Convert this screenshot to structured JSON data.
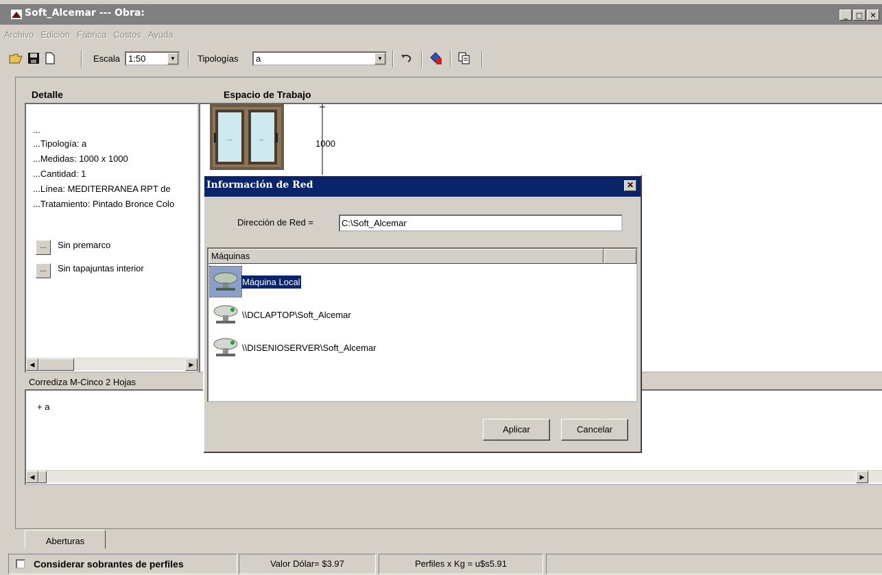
{
  "window": {
    "title": "Soft_Alcemar --- Obra:",
    "controls": [
      "_",
      "□",
      "✕"
    ]
  },
  "menu": [
    "Archivo",
    "Edición",
    "Fábrica",
    "Costos",
    "Ayuda"
  ],
  "toolbar": {
    "scale_label": "Escala",
    "scale_value": "1:50",
    "typologies_label": "Tipologías",
    "typologies_value": "a"
  },
  "detail": {
    "heading": "Detalle",
    "lines": [
      "...",
      "...Tipología: a",
      "...Medidas: 1000 x 1000",
      "...Cantidad: 1",
      "...Línea: MEDITERRANEA RPT de",
      "...Tratamiento: Pintado Bronce Colo"
    ],
    "button_glyph": "...",
    "buttons": [
      "Sin premarco",
      "Sin tapajuntas interior"
    ]
  },
  "workspace": {
    "heading": "Espacio de Trabajo",
    "dimension": "1000"
  },
  "product_label": "Corrediza M-Cinco 2 Hojas",
  "bottom_list": [
    "+ a"
  ],
  "tabs": [
    "Aberturas"
  ],
  "status": {
    "checkbox_label": "Considerar sobrantes de perfiles",
    "checkbox_checked": false,
    "dollar": "Valor Dólar= $3.97",
    "profiles": "Perfiles x Kg = u$s5.91"
  },
  "dialog": {
    "title": "Información de Red",
    "close_glyph": "✕",
    "address_label": "Dirección de Red =",
    "address_value": "C:\\Soft_Alcemar",
    "list_header": "Máquinas",
    "machines": [
      {
        "label": "Máquina Local",
        "selected": true
      },
      {
        "label": "\\\\DCLAPTOP\\Soft_Alcemar",
        "selected": false
      },
      {
        "label": "\\\\DISENIOSERVER\\Soft_Alcemar",
        "selected": false
      }
    ],
    "apply_label": "Aplicar",
    "cancel_label": "Cancelar"
  },
  "colors": {
    "titlebar_inactive": "#808080",
    "dialog_titlebar": "#0a246a",
    "face": "#d4d0c8",
    "window_frame": "#6b5a45",
    "glass": "#cfe8f0"
  },
  "icons": [
    "app-logo-icon",
    "open-folder-icon",
    "save-disk-icon",
    "new-document-icon",
    "undo-icon",
    "paint-bucket-icon",
    "copy-icon",
    "network-drive-icon"
  ]
}
